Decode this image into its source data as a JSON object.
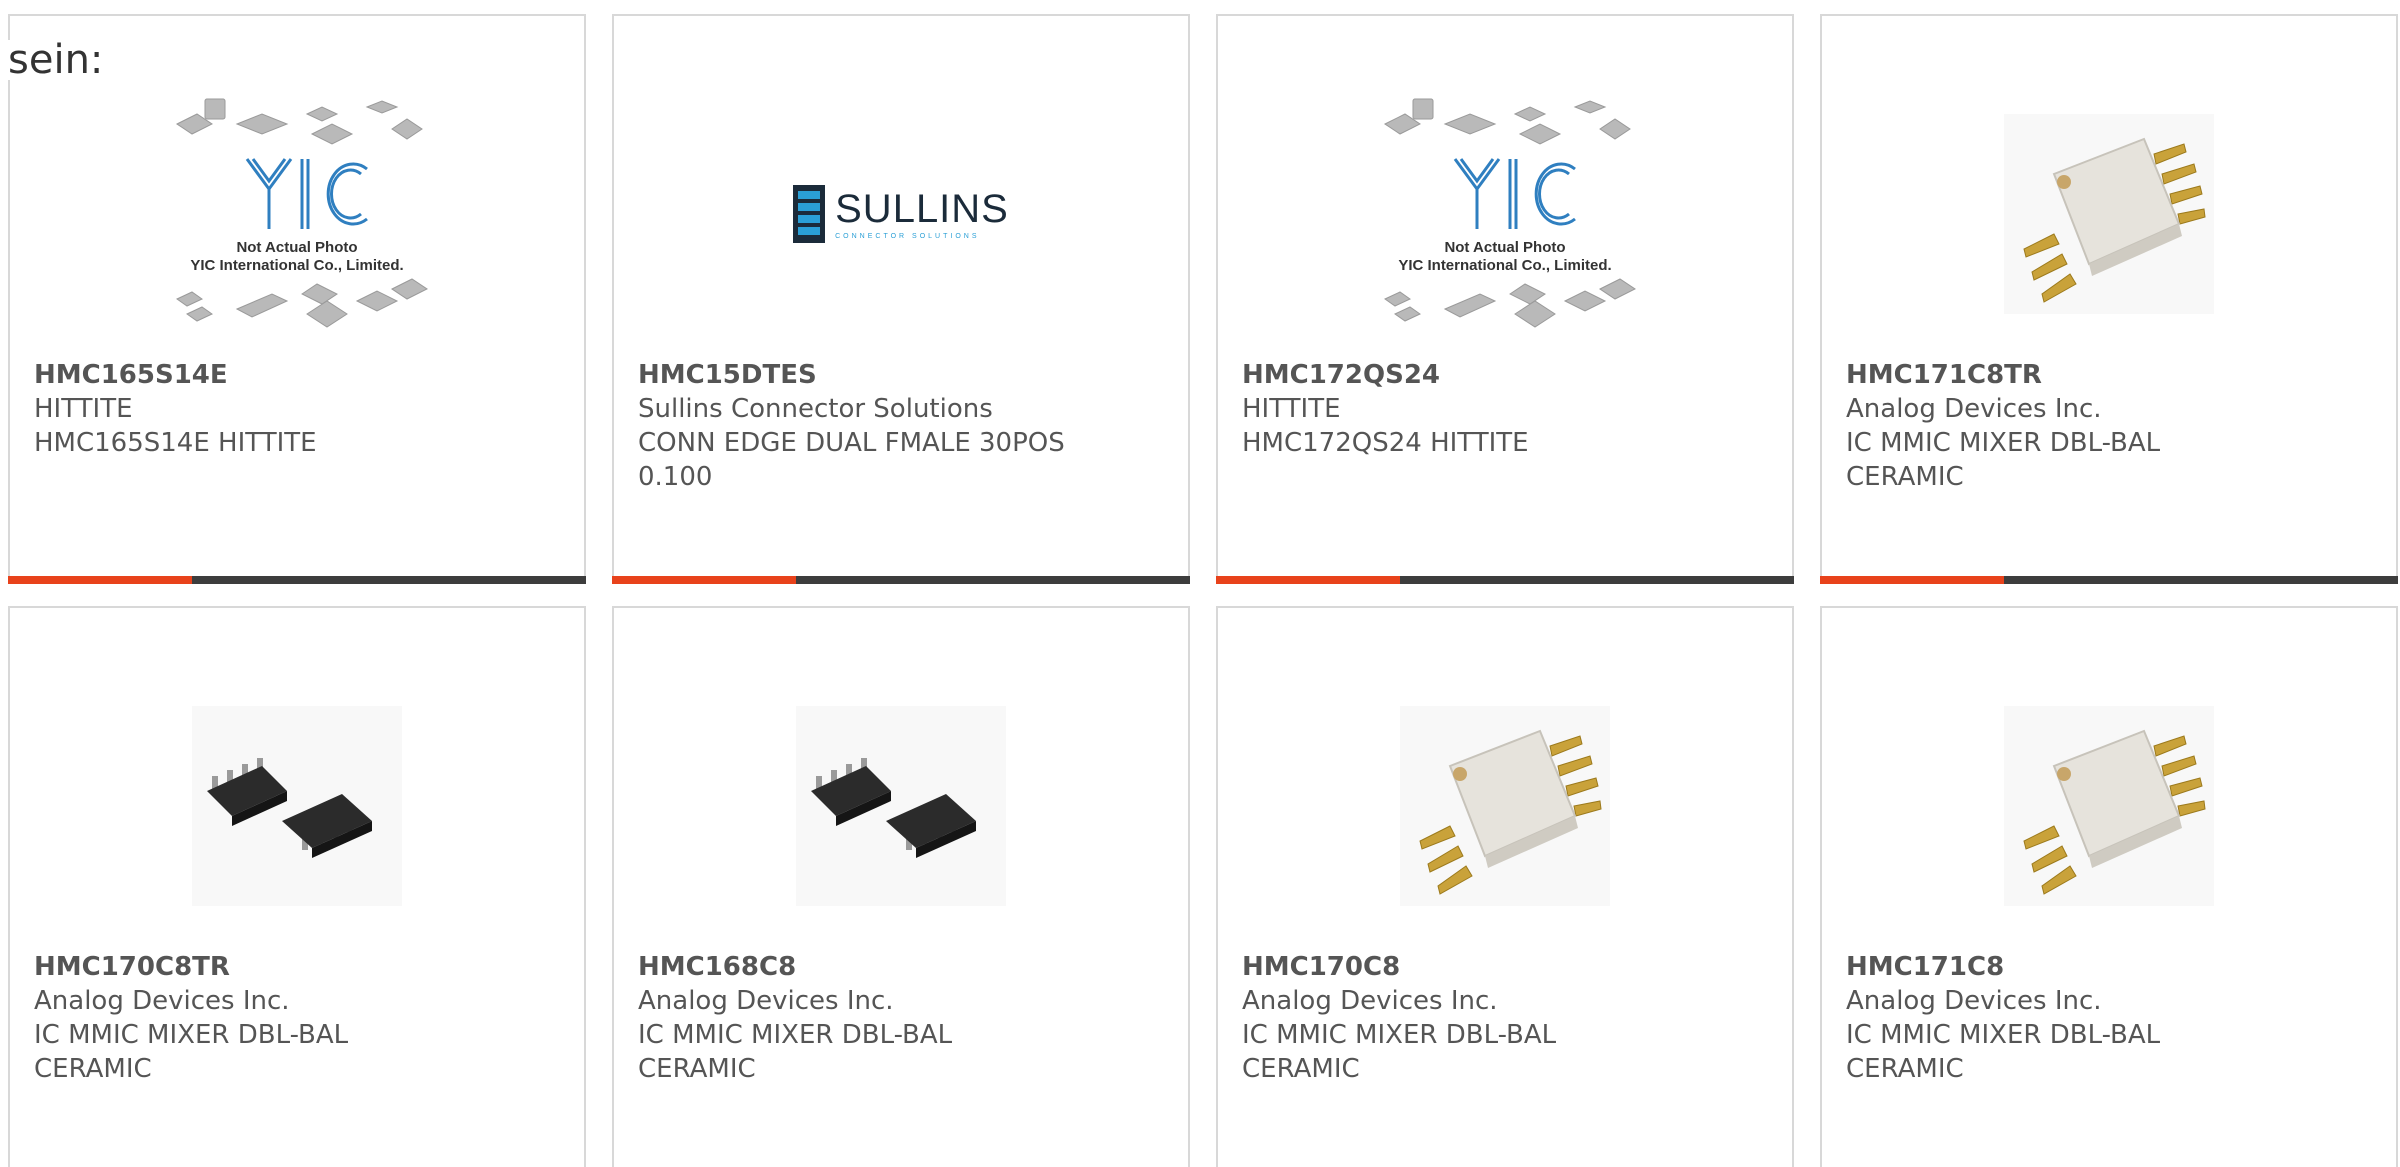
{
  "lead_text": "sein:",
  "colors": {
    "accent": "#e8421b",
    "bar": "#3d3d3d",
    "card_border": "#d8d8d8",
    "text": "#555555"
  },
  "cards": [
    {
      "part_number": "HMC165S14E",
      "manufacturer": "HITTITE",
      "description": "HMC165S14E HITTITE",
      "image": "yic-placeholder",
      "image_caption_1": "Not Actual Photo",
      "image_caption_2": "YIC International Co., Limited."
    },
    {
      "part_number": "HMC15DTES",
      "manufacturer": "Sullins Connector Solutions",
      "description": "CONN EDGE DUAL FMALE 30POS 0.100",
      "image": "sullins-logo",
      "logo_word": "SULLINS",
      "logo_tag": "CONNECTOR SOLUTIONS"
    },
    {
      "part_number": "HMC172QS24",
      "manufacturer": "HITTITE",
      "description": "HMC172QS24 HITTITE",
      "image": "yic-placeholder",
      "image_caption_1": "Not Actual Photo",
      "image_caption_2": "YIC International Co., Limited."
    },
    {
      "part_number": "HMC171C8TR",
      "manufacturer": "Analog Devices Inc.",
      "description": "IC MMIC MIXER DBL-BAL CERAMIC",
      "image": "ceramic-package-photo"
    },
    {
      "part_number": "HMC170C8TR",
      "manufacturer": "Analog Devices Inc.",
      "description": "IC MMIC MIXER DBL-BAL CERAMIC",
      "image": "soic8-package-photo"
    },
    {
      "part_number": "HMC168C8",
      "manufacturer": "Analog Devices Inc.",
      "description": "IC MMIC MIXER DBL-BAL CERAMIC",
      "image": "soic8-package-photo"
    },
    {
      "part_number": "HMC170C8",
      "manufacturer": "Analog Devices Inc.",
      "description": "IC MMIC MIXER DBL-BAL CERAMIC",
      "image": "ceramic-package-photo"
    },
    {
      "part_number": "HMC171C8",
      "manufacturer": "Analog Devices Inc.",
      "description": "IC MMIC MIXER DBL-BAL CERAMIC",
      "image": "ceramic-package-photo"
    }
  ]
}
